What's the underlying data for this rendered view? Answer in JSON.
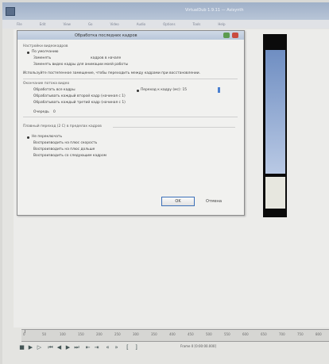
{
  "window": {
    "title": "VirtualDub 1.9.11 — Avisynth"
  },
  "menu": [
    "File",
    "Edit",
    "View",
    "Go",
    "Video",
    "Audio",
    "Options",
    "Tools",
    "Help"
  ],
  "dialog": {
    "title": "Обработка последних кадров",
    "section1": "Настройки видеокадров",
    "opt_default": "По умолчанию",
    "lbl_set": "Заменять",
    "lbl_frames": "кадров в начале",
    "lbl_replace": "Заменять видео кадры для анимации моей работы",
    "desc": "Используйте постепенное замещение, чтобы переходить между кадрами при восстановлении.",
    "section2": "Окончание потока видео",
    "proc_all": "Обработать все кадры",
    "proc_range": "Переход к кадру (мс): 15",
    "proc_prev": "Обрабатывать каждый второй кадр (начиная с 1)",
    "proc_next": "Обрабатывать каждый третий кадр (начиная с 1)",
    "output_label": "Очередь",
    "output_value": "0",
    "section3": "Плавный переход (2 С) в пределах кадров",
    "mode_none": "Не переключать",
    "mode_1": "Воспроизводить на плюс скорость",
    "mode_2": "Воспроизводить на плюс дольше",
    "mode_3": "Воспроизводить со следующим кадром",
    "ok": "OK",
    "cancel": "Отмена"
  },
  "timeline": {
    "ticks": [
      "0",
      "50",
      "100",
      "150",
      "200",
      "250",
      "300",
      "350",
      "400",
      "450",
      "500",
      "550",
      "600",
      "650",
      "700",
      "750",
      "800"
    ],
    "frame_readout": "Frame 0 [0:00:00.000]"
  },
  "colors": {
    "accent": "#4a7fd0",
    "titlebar": "#b8c5d7",
    "close": "#c94a3f",
    "help": "#5c9b50"
  }
}
